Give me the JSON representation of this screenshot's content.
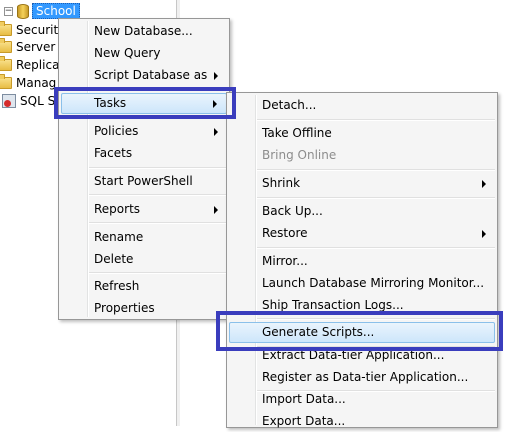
{
  "tree": {
    "selected_node": "School",
    "items": [
      {
        "label": "Securit",
        "icon": "folder-icon"
      },
      {
        "label": "Server",
        "icon": "folder-icon"
      },
      {
        "label": "Replica",
        "icon": "folder-icon"
      },
      {
        "label": "Manag",
        "icon": "folder-icon"
      },
      {
        "label": "SQL S",
        "icon": "sql-agent-icon"
      }
    ]
  },
  "context_menu": {
    "items": {
      "new_database": "New Database...",
      "new_query": "New Query",
      "script_database_as": "Script Database as",
      "tasks": "Tasks",
      "policies": "Policies",
      "facets": "Facets",
      "start_powershell": "Start PowerShell",
      "reports": "Reports",
      "rename": "Rename",
      "delete": "Delete",
      "refresh": "Refresh",
      "properties": "Properties"
    }
  },
  "tasks_menu": {
    "items": {
      "detach": "Detach...",
      "take_offline": "Take Offline",
      "bring_online": "Bring Online",
      "shrink": "Shrink",
      "back_up": "Back Up...",
      "restore": "Restore",
      "mirror": "Mirror...",
      "launch_mirroring_monitor": "Launch Database Mirroring Monitor...",
      "ship_transaction_logs": "Ship Transaction Logs...",
      "generate_scripts": "Generate Scripts...",
      "extract_data_tier": "Extract Data-tier Application...",
      "register_data_tier": "Register as Data-tier Application...",
      "import_data": "Import Data...",
      "export_data": "Export Data..."
    }
  },
  "colors": {
    "highlight_box": "#3a3dbd",
    "hover_item": "#cde6fb",
    "selected_node": "#3399ff",
    "disabled_text": "#8d8d8d"
  }
}
